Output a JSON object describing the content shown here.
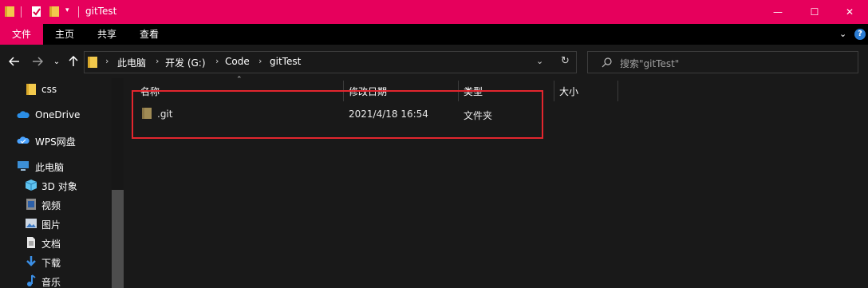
{
  "window": {
    "title": "gitTest",
    "controls": {
      "minimize": "—",
      "maximize": "☐",
      "close": "✕"
    },
    "colors": {
      "titlebar": "#e6005c",
      "highlight_box": "#e3262e",
      "folder": "#f2c94c"
    }
  },
  "ribbon": {
    "tabs": [
      {
        "label": "文件"
      },
      {
        "label": "主页"
      },
      {
        "label": "共享"
      },
      {
        "label": "查看"
      }
    ]
  },
  "address": {
    "breadcrumbs": [
      "此电脑",
      "开发 (G:)",
      "Code",
      "gitTest"
    ]
  },
  "search": {
    "placeholder": "搜索\"gitTest\""
  },
  "nav_pane": {
    "items": [
      {
        "label": "css",
        "icon": "folder-icon"
      },
      {
        "label": "OneDrive",
        "icon": "cloud-icon"
      },
      {
        "label": "WPS网盘",
        "icon": "wps-cloud-icon"
      },
      {
        "label": "此电脑",
        "icon": "computer-icon"
      },
      {
        "label": "3D 对象",
        "icon": "cube-icon"
      },
      {
        "label": "视频",
        "icon": "video-icon"
      },
      {
        "label": "图片",
        "icon": "picture-icon"
      },
      {
        "label": "文档",
        "icon": "document-icon"
      },
      {
        "label": "下载",
        "icon": "download-icon"
      },
      {
        "label": "音乐",
        "icon": "music-icon"
      }
    ]
  },
  "file_list": {
    "columns": [
      "名称",
      "修改日期",
      "类型",
      "大小"
    ],
    "rows": [
      {
        "name": ".git",
        "modified": "2021/4/18 16:54",
        "type": "文件夹",
        "size": ""
      }
    ]
  }
}
